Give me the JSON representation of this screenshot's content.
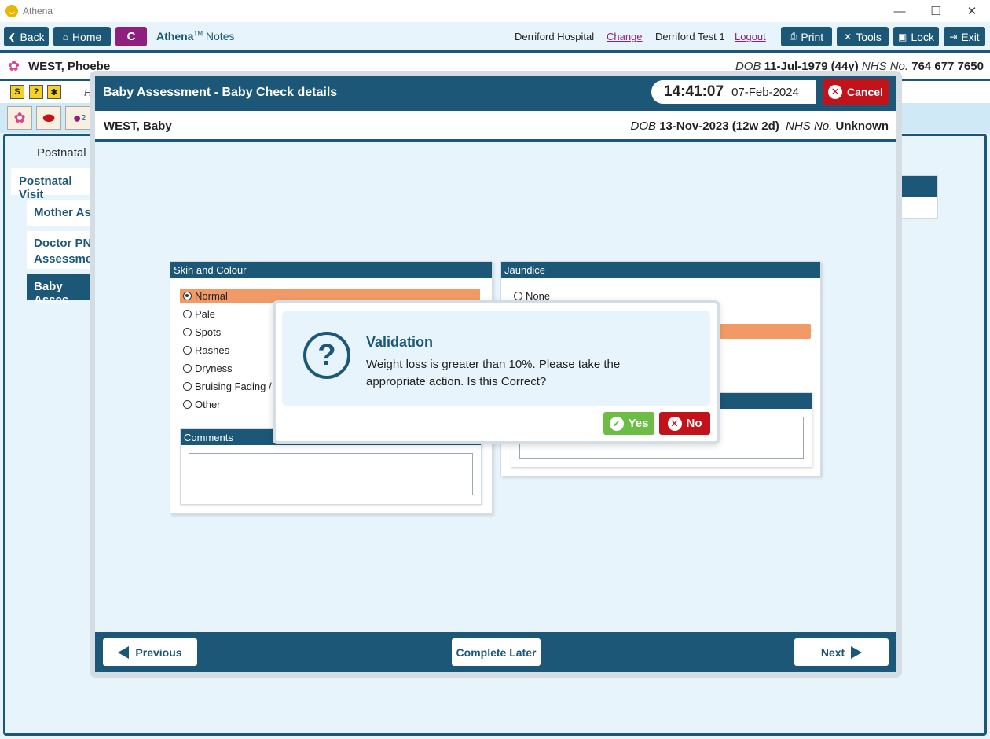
{
  "window": {
    "app_name": "Athena",
    "minimize": "—",
    "maximize": "☐",
    "close": "✕"
  },
  "nav": {
    "back": "Back",
    "home": "Home",
    "c_label": "C",
    "brand_name": "Athena",
    "brand_tm": "TM",
    "brand_suffix": " Notes",
    "hospital": "Derriford Hospital",
    "change": "Change",
    "user": "Derriford Test 1",
    "logout": "Logout",
    "print": "Print",
    "tools": "Tools",
    "lock": "Lock",
    "exit": "Exit"
  },
  "patient": {
    "name": "WEST, Phoebe",
    "dob_label": "DOB",
    "dob": "11-Jul-1979 (44y)",
    "nhs_label": "NHS No.",
    "nhs": "764 677 7650"
  },
  "toolbar": {
    "h_letter": "H",
    "badge_count": "2"
  },
  "background": {
    "postnatal_title": "Postnatal C",
    "postnatal_visit": "Postnatal Visit",
    "side_items": [
      "Mother Ass",
      "Doctor PN Assessmen",
      "Baby Asses"
    ]
  },
  "modal": {
    "title": "Baby Assessment - Baby Check details",
    "time": "14:41:07",
    "date": "07-Feb-2024",
    "cancel": "Cancel",
    "baby_name": "WEST, Baby",
    "baby_dob_label": "DOB",
    "baby_dob": "13-Nov-2023 (12w 2d)",
    "baby_nhs_label": "NHS No.",
    "baby_nhs": "Unknown"
  },
  "skin": {
    "header": "Skin and Colour",
    "options": [
      "Normal",
      "Pale",
      "Spots",
      "Rashes",
      "Dryness",
      "Bruising Fading / I",
      "Other"
    ],
    "selected": "Normal",
    "comments_header": "Comments"
  },
  "jaundice": {
    "header": "Jaundice",
    "options": [
      "None"
    ]
  },
  "footer": {
    "previous": "Previous",
    "complete_later": "Complete Later",
    "next": "Next"
  },
  "validation": {
    "title": "Validation",
    "message": "Weight loss is greater than 10%. Please take the appropriate action. Is this Correct?",
    "yes": "Yes",
    "no": "No"
  },
  "colors": {
    "primary": "#1c5777",
    "danger": "#c4121b",
    "success": "#6cbd45",
    "highlight": "#f19a66",
    "c_button": "#8e1f7e",
    "background": "#e8f4fb"
  }
}
